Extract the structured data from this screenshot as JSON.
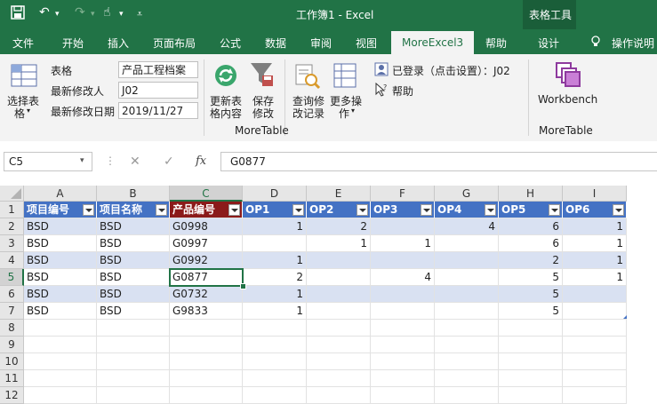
{
  "window": {
    "title": "工作簿1  -  Excel",
    "context_tab": "表格工具"
  },
  "tabs": [
    "文件",
    "开始",
    "插入",
    "页面布局",
    "公式",
    "数据",
    "审阅",
    "视图",
    "MoreExcel3",
    "帮助",
    "设计",
    "操作说明"
  ],
  "ribbon": {
    "select_table_label": "选择表格",
    "select_table_line1": "选择表",
    "select_table_line2": "格",
    "fields": [
      {
        "label": "表格",
        "value": "产品工程档案"
      },
      {
        "label": "最新修改人",
        "value": "J02"
      },
      {
        "label": "最新修改日期",
        "value": "2019/11/27"
      }
    ],
    "buttons": [
      {
        "line1": "更新表",
        "line2": "格内容"
      },
      {
        "line1": "保存",
        "line2": "修改"
      },
      {
        "line1": "查询修",
        "line2": "改记录"
      },
      {
        "line1": "更多操",
        "line2": "作"
      }
    ],
    "login_text": "已登录（点击设置）：J02",
    "help_text": "帮助",
    "group_moretable": "MoreTable",
    "workbench_label": "Workbench",
    "group_moretable2": "MoreTable"
  },
  "formula_bar": {
    "name_box": "C5",
    "cancel": "✕",
    "enter": "✓",
    "fx": "fx",
    "value": "G0877"
  },
  "columns": [
    "A",
    "B",
    "C",
    "D",
    "E",
    "F",
    "G",
    "H",
    "I"
  ],
  "selected_column": "C",
  "selected_row": "5",
  "rows": [
    "1",
    "2",
    "3",
    "4",
    "5",
    "6",
    "7",
    "8",
    "9",
    "10",
    "11",
    "12"
  ],
  "table": {
    "headers": [
      "项目编号",
      "项目名称",
      "产品编号",
      "OP1",
      "OP2",
      "OP3",
      "OP4",
      "OP5",
      "OP6"
    ],
    "data": [
      [
        "BSD",
        "BSD",
        "G0998",
        "1",
        "2",
        "",
        "4",
        "6",
        "1"
      ],
      [
        "BSD",
        "BSD",
        "G0997",
        "",
        "1",
        "1",
        "",
        "6",
        "1"
      ],
      [
        "BSD",
        "BSD",
        "G0992",
        "1",
        "",
        "",
        "",
        "2",
        "1"
      ],
      [
        "BSD",
        "BSD",
        "G0877",
        "2",
        "",
        "4",
        "",
        "5",
        "1"
      ],
      [
        "BSD",
        "BSD",
        "G0732",
        "1",
        "",
        "",
        "",
        "5",
        ""
      ],
      [
        "BSD",
        "BSD",
        "G9833",
        "1",
        "",
        "",
        "",
        "5",
        ""
      ]
    ]
  },
  "colors": {
    "excel_green": "#217346",
    "table_header": "#4472c4",
    "band": "#d9e1f2",
    "active_header": "#8b1a1a"
  }
}
